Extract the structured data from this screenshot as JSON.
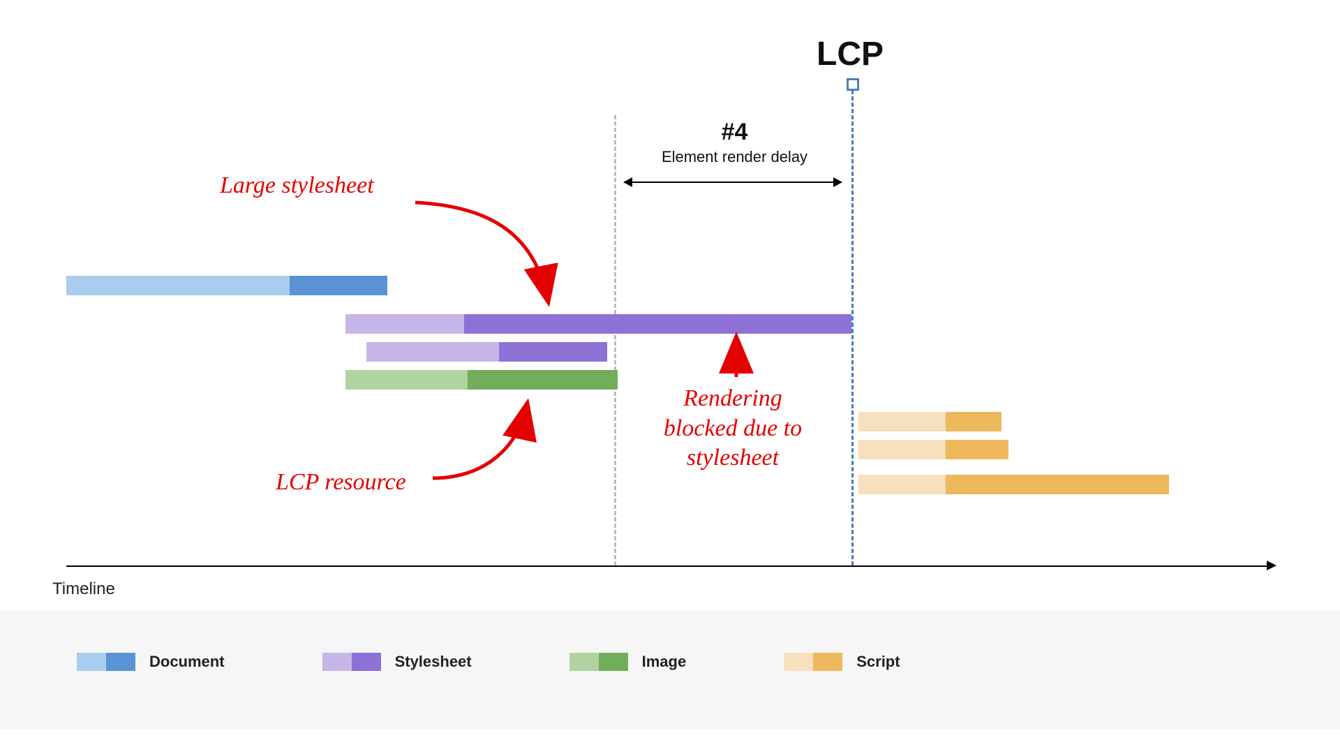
{
  "title": "LCP",
  "section": {
    "num": "#4",
    "label": "Element render delay"
  },
  "annotations": {
    "large_stylesheet": "Large stylesheet",
    "lcp_resource": "LCP resource",
    "render_block_l1": "Rendering",
    "render_block_l2": "blocked due to",
    "render_block_l3": "stylesheet"
  },
  "axis_label": "Timeline",
  "legend": {
    "document": "Document",
    "stylesheet": "Stylesheet",
    "image": "Image",
    "script": "Script"
  },
  "chart_data": {
    "type": "bar",
    "orientation": "horizontal-gantt",
    "x_unit": "px (relative timeline position)",
    "x_range": [
      0,
      1720
    ],
    "markers": {
      "render_delay_start": 785,
      "lcp": 1125
    },
    "phase": {
      "name": "Element render delay",
      "start": 785,
      "end": 1125
    },
    "bars": [
      {
        "row": 0,
        "type": "document",
        "start": 0,
        "light_end": 320,
        "end": 460
      },
      {
        "row": 1,
        "type": "stylesheet",
        "start": 400,
        "light_end": 570,
        "end": 1125
      },
      {
        "row": 2,
        "type": "stylesheet",
        "start": 430,
        "light_end": 620,
        "end": 775
      },
      {
        "row": 3,
        "type": "image",
        "start": 400,
        "light_end": 575,
        "end": 790
      },
      {
        "row": 4,
        "type": "script",
        "start": 1135,
        "light_end": 1260,
        "end": 1340
      },
      {
        "row": 5,
        "type": "script",
        "start": 1135,
        "light_end": 1260,
        "end": 1350
      },
      {
        "row": 6,
        "type": "script",
        "start": 1135,
        "light_end": 1260,
        "end": 1580
      }
    ]
  }
}
